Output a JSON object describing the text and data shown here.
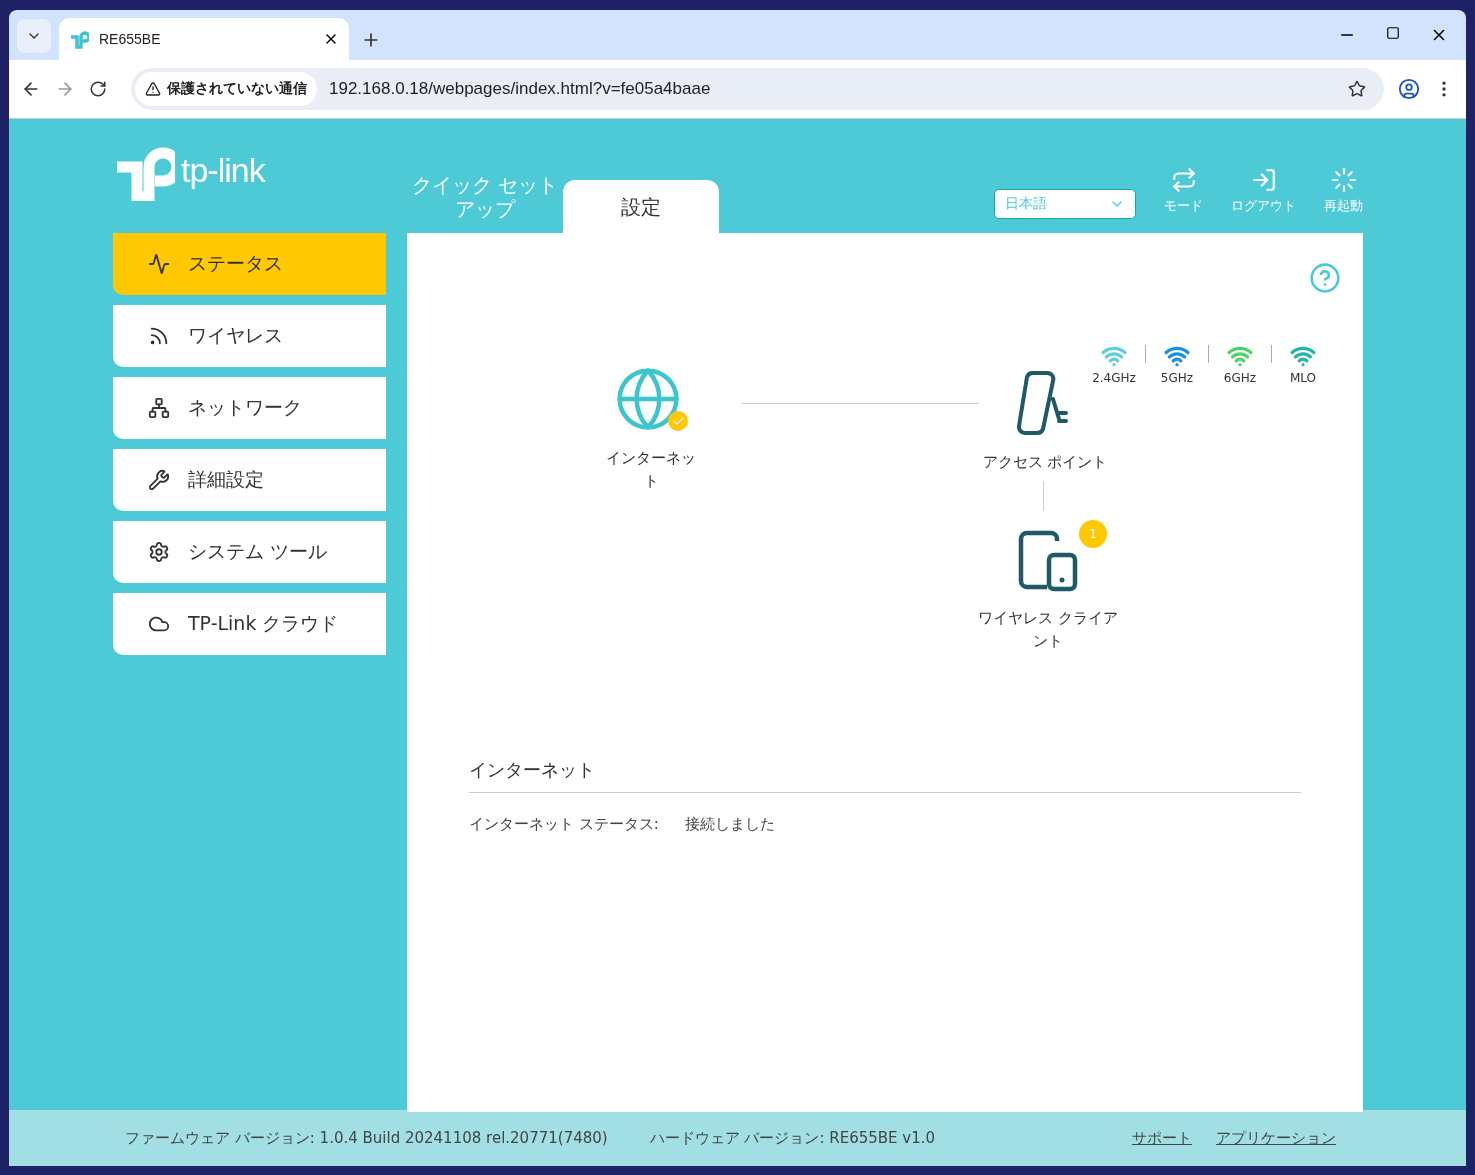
{
  "browser": {
    "tab_title": "RE655BE",
    "security_label": "保護されていない通信",
    "url": "192.168.0.18/webpages/index.html?v=fe05a4baae"
  },
  "brand": "tp-link",
  "top_tabs": [
    {
      "label": "クイック セットアップ",
      "selected": false
    },
    {
      "label": "設定",
      "selected": true
    }
  ],
  "language": {
    "value": "日本語"
  },
  "header_actions": [
    {
      "kind": "mode",
      "label": "モード"
    },
    {
      "kind": "logout",
      "label": "ログアウト"
    },
    {
      "kind": "reboot",
      "label": "再起動"
    }
  ],
  "sidebar": {
    "items": [
      {
        "kind": "status",
        "label": "ステータス",
        "selected": true
      },
      {
        "kind": "wireless",
        "label": "ワイヤレス",
        "selected": false
      },
      {
        "kind": "network",
        "label": "ネットワーク",
        "selected": false
      },
      {
        "kind": "advanced",
        "label": "詳細設定",
        "selected": false
      },
      {
        "kind": "tools",
        "label": "システム ツール",
        "selected": false
      },
      {
        "kind": "cloud",
        "label": "TP-Link クラウド",
        "selected": false
      }
    ]
  },
  "topology": {
    "internet": {
      "label": "インターネット"
    },
    "access_point": {
      "label": "アクセス ポイント"
    },
    "bands": [
      {
        "label": "2.4GHz",
        "color": "#5ccfe0"
      },
      {
        "label": "5GHz",
        "color": "#1b8fe0"
      },
      {
        "label": "6GHz",
        "color": "#4cd46a"
      },
      {
        "label": "MLO",
        "color": "#23b8a4"
      }
    ],
    "clients": {
      "label": "ワイヤレス クライアント",
      "count": "1"
    }
  },
  "internet_section": {
    "title": "インターネット",
    "fields": [
      {
        "label": "インターネット ステータス:",
        "value": "接続しました"
      }
    ]
  },
  "footer": {
    "firmware": "ファームウェア バージョン: 1.0.4 Build 20241108 rel.20771(7480)",
    "hardware": "ハードウェア バージョン: RE655BE v1.0",
    "links": [
      "サポート",
      "アプリケーション"
    ]
  }
}
